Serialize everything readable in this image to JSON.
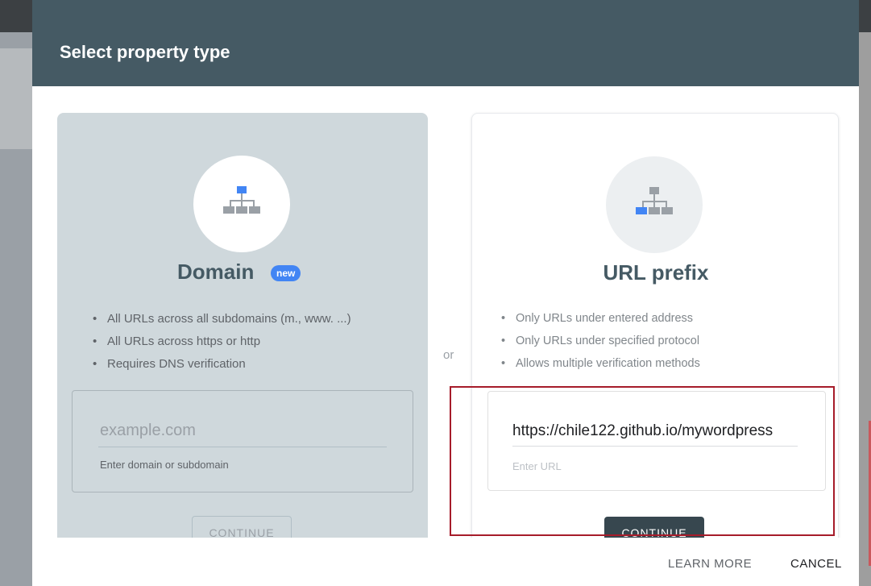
{
  "dialog": {
    "title": "Select property type",
    "separator": "or"
  },
  "domain_card": {
    "title": "Domain",
    "badge": "new",
    "features": [
      "All URLs across all subdomains (m., www. ...)",
      "All URLs across https or http",
      "Requires DNS verification"
    ],
    "input": {
      "placeholder": "example.com",
      "hint": "Enter domain or subdomain"
    },
    "continue_label": "CONTINUE",
    "icon": "sitemap-icon"
  },
  "url_card": {
    "title": "URL prefix",
    "features": [
      "Only URLs under entered address",
      "Only URLs under specified protocol",
      "Allows multiple verification methods"
    ],
    "input": {
      "value": "https://chile122.github.io/mywordpress",
      "hint": "Enter URL"
    },
    "continue_label": "CONTINUE",
    "icon": "sitemap-icon"
  },
  "footer": {
    "learn_more": "LEARN MORE",
    "cancel": "CANCEL"
  },
  "colors": {
    "header": "#455a64",
    "domain_card_bg": "#cfd8dc",
    "badge": "#4285f4",
    "highlight": "#a61c2a",
    "continue_active": "#37474f"
  }
}
